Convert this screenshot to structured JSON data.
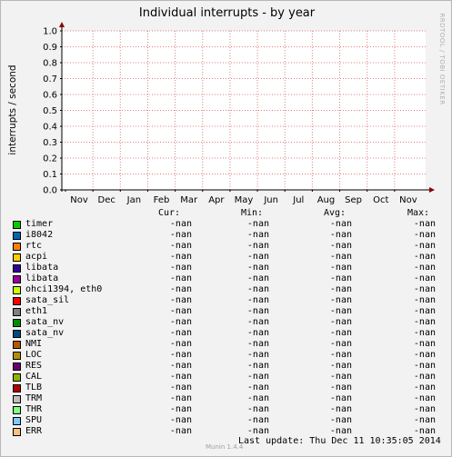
{
  "title": "Individual interrupts - by year",
  "watermark": "RRDTOOL / TOBI OETIKER",
  "version": "Munin 1.4.4",
  "footer": {
    "label": "Last update:",
    "value": "Thu Dec 11 10:35:05 2014"
  },
  "legend_headers": {
    "cur": "Cur:",
    "min": "Min:",
    "avg": "Avg:",
    "max": "Max:"
  },
  "chart_data": {
    "type": "line",
    "title": "Individual interrupts - by year",
    "ylabel": "interrupts / second",
    "xlabel": "",
    "ylim": [
      0.0,
      1.0
    ],
    "yticks": [
      "0.0",
      "0.1",
      "0.2",
      "0.3",
      "0.4",
      "0.5",
      "0.6",
      "0.7",
      "0.8",
      "0.9",
      "1.0"
    ],
    "categories": [
      "Nov",
      "Dec",
      "Jan",
      "Feb",
      "Mar",
      "Apr",
      "May",
      "Jun",
      "Jul",
      "Aug",
      "Sep",
      "Oct",
      "Nov"
    ],
    "grid": true,
    "series": [
      {
        "name": "timer",
        "color": "#00cc00",
        "cur": "-nan",
        "min": "-nan",
        "avg": "-nan",
        "max": "-nan",
        "values": []
      },
      {
        "name": "i8042",
        "color": "#0066b3",
        "cur": "-nan",
        "min": "-nan",
        "avg": "-nan",
        "max": "-nan",
        "values": []
      },
      {
        "name": "rtc",
        "color": "#ff8000",
        "cur": "-nan",
        "min": "-nan",
        "avg": "-nan",
        "max": "-nan",
        "values": []
      },
      {
        "name": "acpi",
        "color": "#ffcc00",
        "cur": "-nan",
        "min": "-nan",
        "avg": "-nan",
        "max": "-nan",
        "values": []
      },
      {
        "name": "libata",
        "color": "#330099",
        "cur": "-nan",
        "min": "-nan",
        "avg": "-nan",
        "max": "-nan",
        "values": []
      },
      {
        "name": "libata",
        "color": "#990099",
        "cur": "-nan",
        "min": "-nan",
        "avg": "-nan",
        "max": "-nan",
        "values": []
      },
      {
        "name": "ohci1394, eth0",
        "color": "#ccff00",
        "cur": "-nan",
        "min": "-nan",
        "avg": "-nan",
        "max": "-nan",
        "values": []
      },
      {
        "name": "sata_sil",
        "color": "#ff0000",
        "cur": "-nan",
        "min": "-nan",
        "avg": "-nan",
        "max": "-nan",
        "values": []
      },
      {
        "name": "eth1",
        "color": "#808080",
        "cur": "-nan",
        "min": "-nan",
        "avg": "-nan",
        "max": "-nan",
        "values": []
      },
      {
        "name": "sata_nv",
        "color": "#008f00",
        "cur": "-nan",
        "min": "-nan",
        "avg": "-nan",
        "max": "-nan",
        "values": []
      },
      {
        "name": "sata_nv",
        "color": "#00487d",
        "cur": "-nan",
        "min": "-nan",
        "avg": "-nan",
        "max": "-nan",
        "values": []
      },
      {
        "name": "NMI",
        "color": "#b35a00",
        "cur": "-nan",
        "min": "-nan",
        "avg": "-nan",
        "max": "-nan",
        "values": []
      },
      {
        "name": "LOC",
        "color": "#b38f00",
        "cur": "-nan",
        "min": "-nan",
        "avg": "-nan",
        "max": "-nan",
        "values": []
      },
      {
        "name": "RES",
        "color": "#6b006b",
        "cur": "-nan",
        "min": "-nan",
        "avg": "-nan",
        "max": "-nan",
        "values": []
      },
      {
        "name": "CAL",
        "color": "#8fb300",
        "cur": "-nan",
        "min": "-nan",
        "avg": "-nan",
        "max": "-nan",
        "values": []
      },
      {
        "name": "TLB",
        "color": "#b30000",
        "cur": "-nan",
        "min": "-nan",
        "avg": "-nan",
        "max": "-nan",
        "values": []
      },
      {
        "name": "TRM",
        "color": "#bebebe",
        "cur": "-nan",
        "min": "-nan",
        "avg": "-nan",
        "max": "-nan",
        "values": []
      },
      {
        "name": "THR",
        "color": "#80ff80",
        "cur": "-nan",
        "min": "-nan",
        "avg": "-nan",
        "max": "-nan",
        "values": []
      },
      {
        "name": "SPU",
        "color": "#80c9ff",
        "cur": "-nan",
        "min": "-nan",
        "avg": "-nan",
        "max": "-nan",
        "values": []
      },
      {
        "name": "ERR",
        "color": "#ffc080",
        "cur": "-nan",
        "min": "-nan",
        "avg": "-nan",
        "max": "-nan",
        "values": []
      }
    ]
  }
}
